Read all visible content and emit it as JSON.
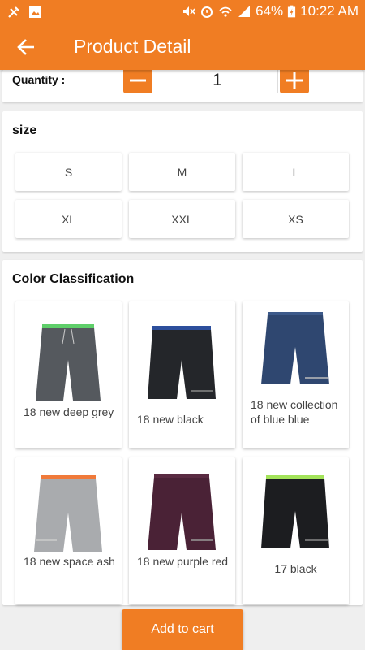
{
  "status_bar": {
    "battery": "64%",
    "time": "10:22 AM",
    "icons": [
      "tools-icon",
      "image-icon",
      "mute-icon",
      "alarm-icon",
      "wifi-icon",
      "signal-icon",
      "battery-charging-icon"
    ]
  },
  "app_bar": {
    "back_icon": "arrow-back-icon",
    "title": "Product Detail"
  },
  "quantity": {
    "label": "Quantity :",
    "value": "1",
    "minus_icon": "minus-icon",
    "plus_icon": "plus-icon"
  },
  "size": {
    "title": "size",
    "options": [
      "S",
      "M",
      "L",
      "XL",
      "XXL",
      "XS"
    ]
  },
  "color_classification": {
    "title": "Color Classification",
    "items": [
      {
        "name": "18 new deep grey",
        "color": "#55595e",
        "waist": "#5fcf6a"
      },
      {
        "name": "18 new black",
        "color": "#24262a",
        "waist": "#2d4f9c"
      },
      {
        "name": "18 new collection of blue blue",
        "color": "#2f4770",
        "waist": "#2f4770"
      },
      {
        "name": "18 new space ash",
        "color": "#a9abae",
        "waist": "#f07a3a"
      },
      {
        "name": "18 new purple red",
        "color": "#4a2236",
        "waist": "#4a2236"
      },
      {
        "name": "17 black",
        "color": "#1c1d20",
        "waist": "#a3e35a"
      }
    ]
  },
  "add_to_cart": "Add to cart",
  "colors": {
    "accent": "#f07d23",
    "background": "#efefef"
  }
}
